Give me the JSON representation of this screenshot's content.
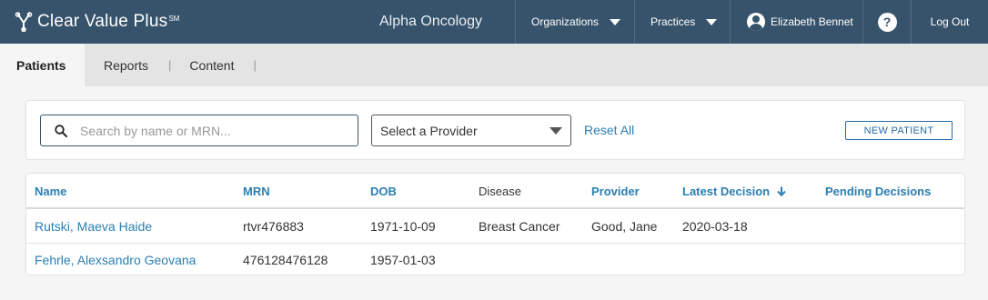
{
  "header": {
    "brand_name": "Clear Value Plus",
    "brand_mark": "SM",
    "org_title": "Alpha Oncology",
    "organizations_label": "Organizations",
    "practices_label": "Practices",
    "user_name": "Elizabeth Bennet",
    "help_label": "?",
    "logout_label": "Log Out"
  },
  "tabs": [
    {
      "label": "Patients",
      "active": true
    },
    {
      "label": "Reports",
      "active": false
    },
    {
      "label": "Content",
      "active": false
    }
  ],
  "tab_separator": "|",
  "search": {
    "placeholder": "Search by name or MRN...",
    "value": "",
    "provider_select_label": "Select a Provider",
    "reset_label": "Reset All",
    "new_patient_label": "NEW PATIENT"
  },
  "table": {
    "columns": [
      "Name",
      "MRN",
      "DOB",
      "Disease",
      "Provider",
      "Latest Decision",
      "Pending Decisions"
    ],
    "sort_column": "Latest Decision",
    "sort_direction": "descending",
    "rows": [
      {
        "name": "Rutski, Maeva Haide",
        "mrn": "rtvr476883",
        "dob": "1971-10-09",
        "disease": "Breast Cancer",
        "provider": "Good, Jane",
        "latest_decision": "2020-03-18",
        "pending_decisions": ""
      },
      {
        "name": "Fehrle, Alexsandro Geovana",
        "mrn": "476128476128",
        "dob": "1957-01-03",
        "disease": "",
        "provider": "",
        "latest_decision": "",
        "pending_decisions": ""
      }
    ]
  },
  "colors": {
    "header_bg": "#37536b",
    "link": "#2a7fb3",
    "tabbar_bg": "#e4e4e4",
    "page_bg": "#f5f5f5"
  },
  "icons": {
    "brand": "branch-logo-icon",
    "organizations": "chevron-down-icon",
    "practices": "chevron-down-icon",
    "user": "user-avatar-icon",
    "help": "help-icon",
    "search": "search-icon",
    "sort": "arrow-down-icon"
  }
}
